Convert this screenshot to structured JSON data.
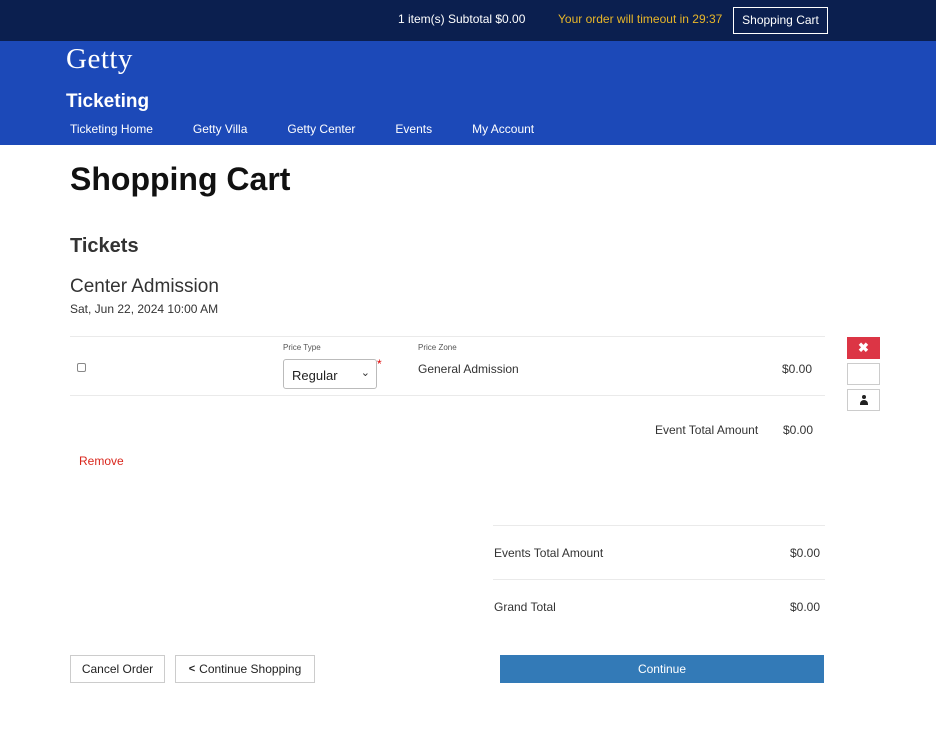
{
  "topbar": {
    "summary": "1 item(s) Subtotal $0.00",
    "timeout": "Your order will timeout in 29:37",
    "cart_button": "Shopping Cart"
  },
  "brand": {
    "logo": "Getty",
    "site_name": "Ticketing"
  },
  "nav": {
    "items": [
      {
        "label": "Ticketing Home"
      },
      {
        "label": "Getty Villa"
      },
      {
        "label": "Getty Center"
      },
      {
        "label": "Events"
      },
      {
        "label": "My Account"
      }
    ]
  },
  "page": {
    "title": "Shopping Cart",
    "section_title": "Tickets"
  },
  "event": {
    "name": "Center Admission",
    "date": "Sat, Jun 22, 2024 10:00 AM",
    "price_type_label": "Price Type",
    "price_type_value": "Regular",
    "required_mark": "*",
    "price_zone_label": "Price Zone",
    "price_zone_value": "General Admission",
    "price": "$0.00",
    "remove_icon": "✖",
    "total_label": "Event Total Amount",
    "total_value": "$0.00",
    "remove_link": "Remove"
  },
  "summary": {
    "events_total_label": "Events Total Amount",
    "events_total_value": "$0.00",
    "grand_total_label": "Grand Total",
    "grand_total_value": "$0.00"
  },
  "actions": {
    "cancel": "Cancel Order",
    "continue_shopping": "Continue Shopping",
    "continue": "Continue"
  }
}
